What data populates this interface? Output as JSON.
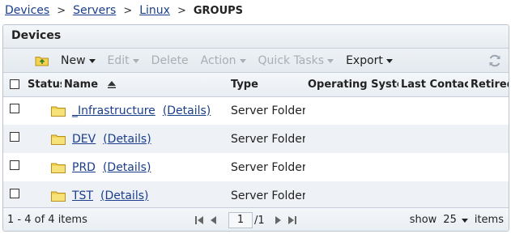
{
  "breadcrumb": {
    "items": [
      "Devices",
      "Servers",
      "Linux"
    ],
    "separator": ">",
    "current": "GROUPS"
  },
  "panel": {
    "title": "Devices"
  },
  "toolbar": {
    "up_icon": "folder-up-icon",
    "new_label": "New",
    "edit_label": "Edit",
    "delete_label": "Delete",
    "action_label": "Action",
    "quick_tasks_label": "Quick Tasks",
    "export_label": "Export",
    "refresh_icon": "refresh-icon"
  },
  "table": {
    "columns": {
      "status": "Status",
      "name": "Name",
      "type": "Type",
      "os": "Operating System",
      "last_contact": "Last Contact",
      "retired": "Retired"
    },
    "sort": {
      "column": "Name",
      "direction": "ascending"
    },
    "rows": [
      {
        "name": "_Infrastructure",
        "details": "(Details)",
        "type": "Server Folder"
      },
      {
        "name": "DEV",
        "details": "(Details)",
        "type": "Server Folder"
      },
      {
        "name": "PRD",
        "details": "(Details)",
        "type": "Server Folder"
      },
      {
        "name": "TST",
        "details": "(Details)",
        "type": "Server Folder"
      }
    ]
  },
  "footer": {
    "count_text": "1 - 4 of 4 items",
    "page_value": "1",
    "page_total": "/1",
    "show_label": "show",
    "page_size": "25",
    "items_label": "items"
  },
  "colors": {
    "link": "#1a3e8c",
    "disabled": "#a9aeb5",
    "folder": "#f2d24f",
    "row_alt": "#eef1f5",
    "border": "#b9c3cf"
  }
}
